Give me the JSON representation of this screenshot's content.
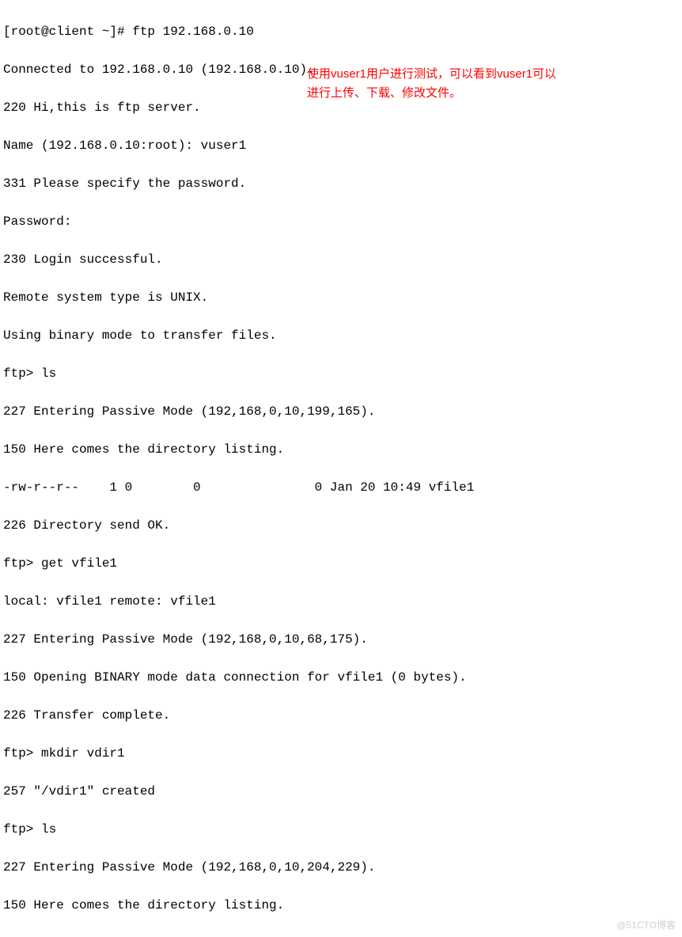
{
  "terminal": {
    "lines": {
      "l0": "[root@client ~]# ftp 192.168.0.10",
      "l1": "Connected to 192.168.0.10 (192.168.0.10).",
      "l2": "220 Hi,this is ftp server.",
      "l3": "Name (192.168.0.10:root): vuser1",
      "l4": "331 Please specify the password.",
      "l5": "Password:",
      "l6": "230 Login successful.",
      "l7": "Remote system type is UNIX.",
      "l8": "Using binary mode to transfer files.",
      "l9": "ftp> ls",
      "l10": "227 Entering Passive Mode (192,168,0,10,199,165).",
      "l11": "150 Here comes the directory listing.",
      "l12": "-rw-r--r--    1 0        0               0 Jan 20 10:49 vfile1",
      "l13": "226 Directory send OK.",
      "l14": "ftp> get vfile1",
      "l15": "local: vfile1 remote: vfile1",
      "l16": "227 Entering Passive Mode (192,168,0,10,68,175).",
      "l17": "150 Opening BINARY mode data connection for vfile1 (0 bytes).",
      "l18": "226 Transfer complete.",
      "l19": "ftp> mkdir vdir1",
      "l20": "257 \"/vdir1\" created",
      "l21": "ftp> ls",
      "l22": "227 Entering Passive Mode (192,168,0,10,204,229).",
      "l23": "150 Here comes the directory listing."
    }
  },
  "annotation": {
    "line1": "使用vuser1用户进行测试，可以看到vuser1可以",
    "line2": "进行上传、下载、修改文件。"
  },
  "watermark": "@51CTO博客"
}
